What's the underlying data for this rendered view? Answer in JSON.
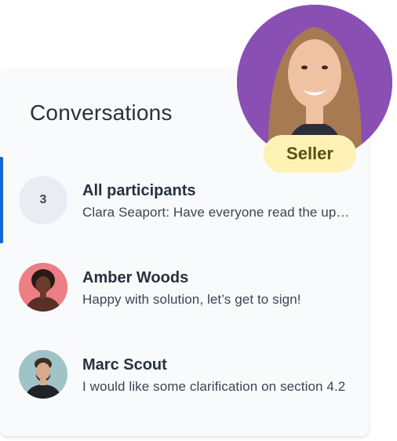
{
  "panel": {
    "title": "Conversations"
  },
  "conversations": [
    {
      "avatar_text": "3",
      "name": "All participants",
      "preview": "Clara Seaport: Have everyone read the updated terms?",
      "active": true
    },
    {
      "avatar_icon": "person-avatar-icon",
      "name": "Amber Woods",
      "preview": "Happy with solution, let’s get to sign!",
      "active": false
    },
    {
      "avatar_icon": "person-avatar-icon",
      "name": "Marc Scout",
      "preview": "I would like some clarification on section 4.2",
      "active": false
    }
  ],
  "seller": {
    "badge": "Seller"
  },
  "colors": {
    "accent": "#1565d8",
    "panel_bg": "#f9fafb",
    "seller_badge_bg": "#fdf2b4",
    "seller_photo_bg": "#8a4fb3"
  }
}
